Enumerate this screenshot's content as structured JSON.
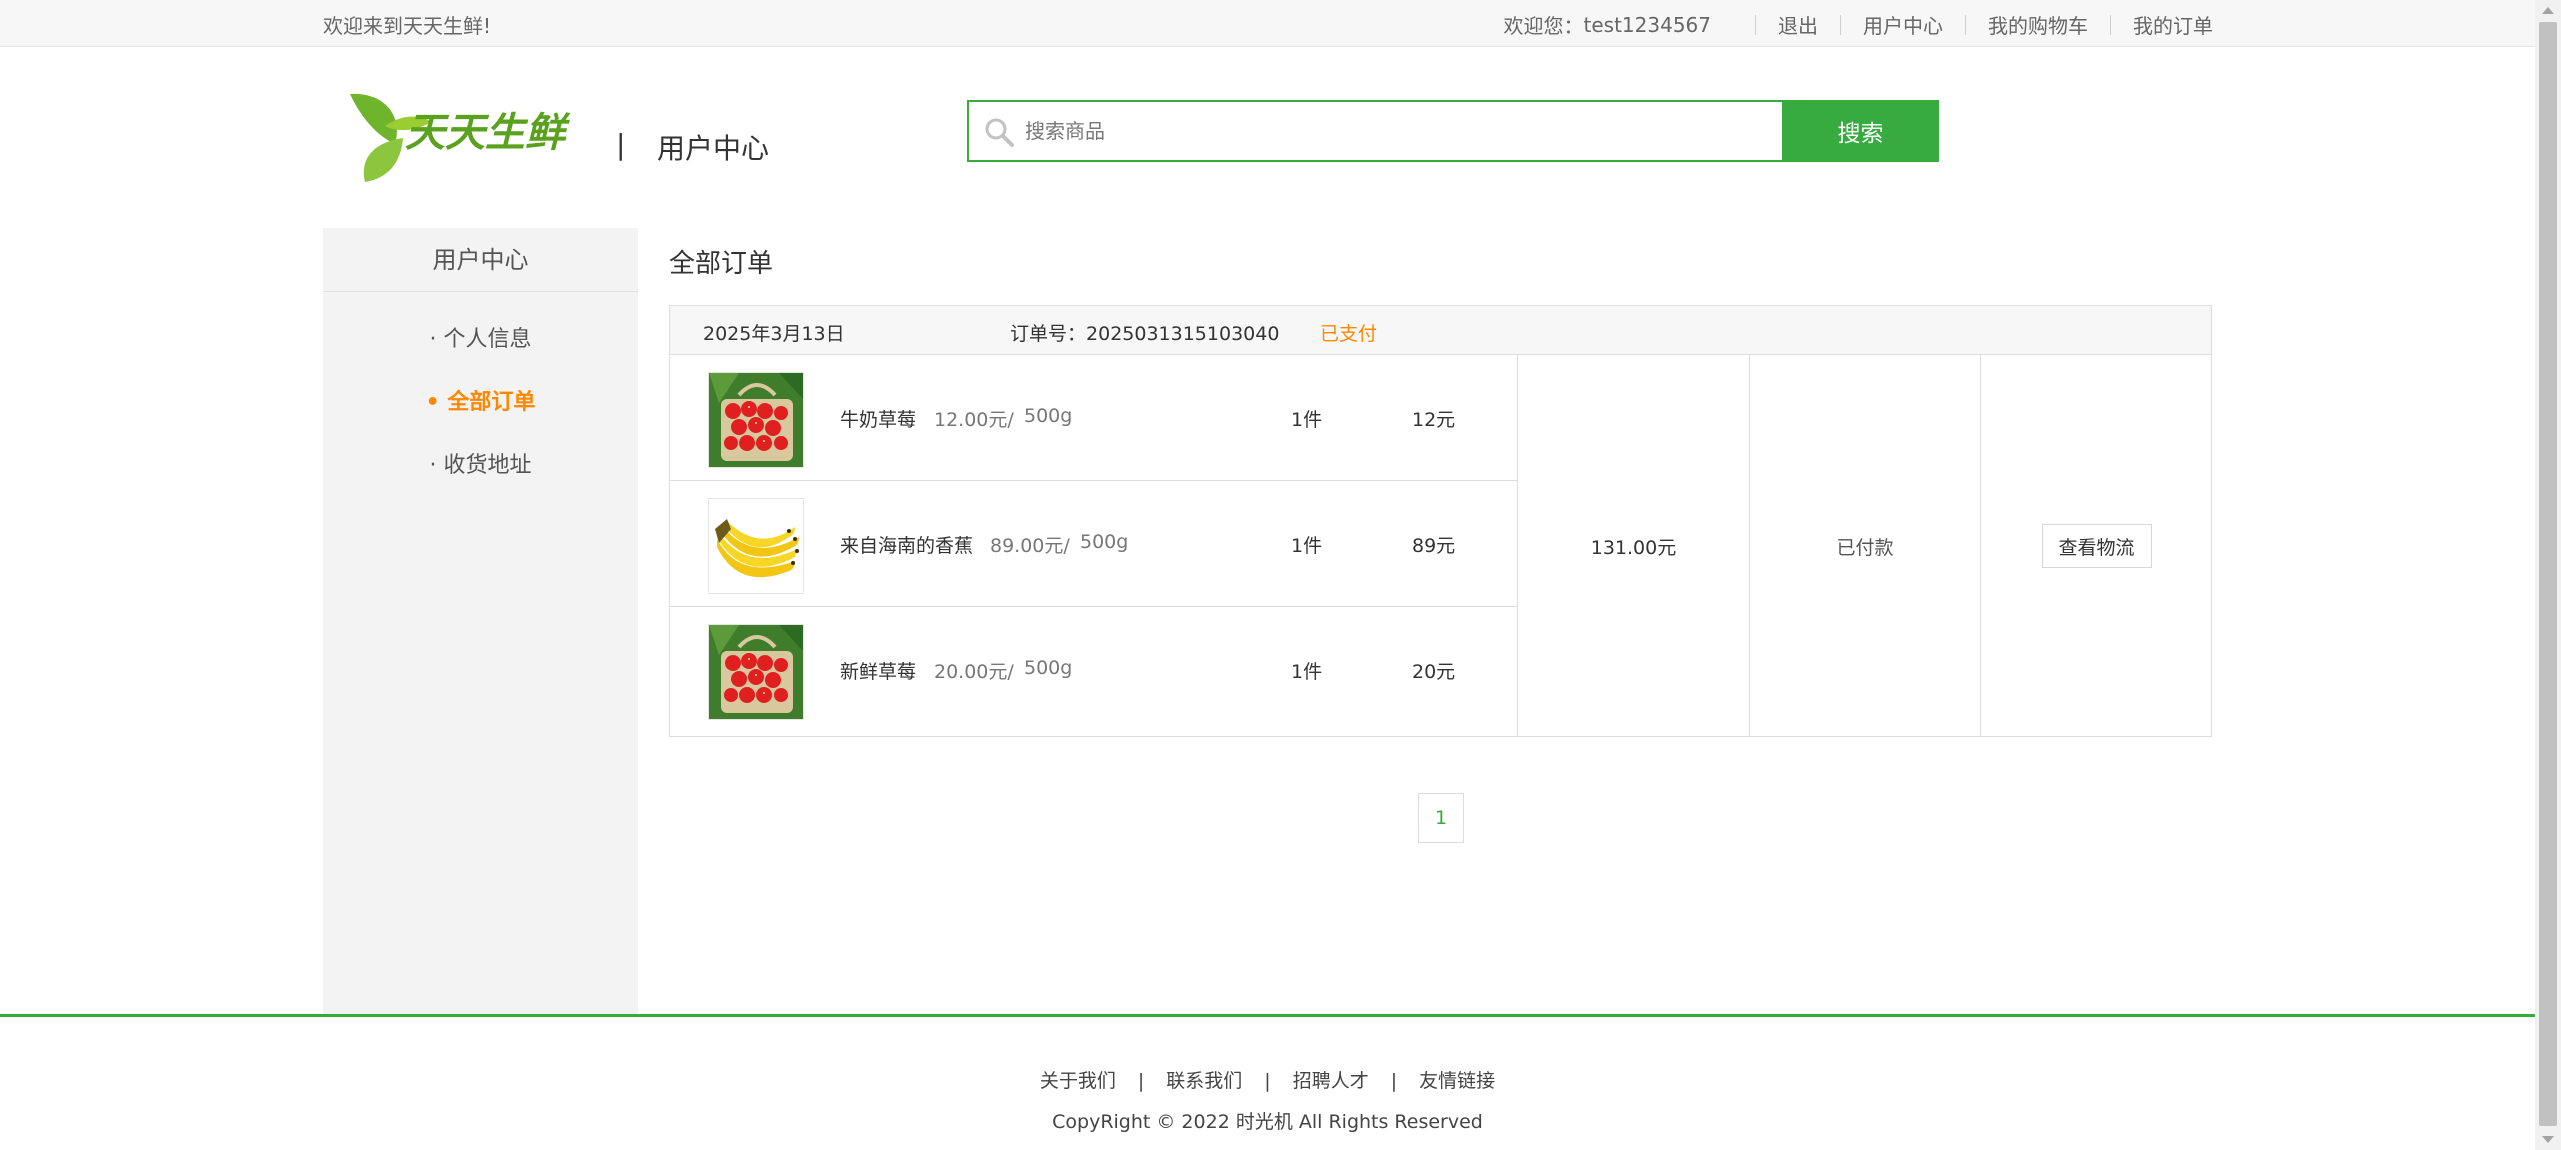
{
  "topbar": {
    "welcome": "欢迎来到天天生鲜!",
    "user_label": "欢迎您：",
    "username": "test1234567",
    "links": [
      "退出",
      "用户中心",
      "我的购物车",
      "我的订单"
    ]
  },
  "header": {
    "logo_text": "天天生鲜",
    "divider": "|",
    "subtitle": "用户中心",
    "search_placeholder": "搜索商品",
    "search_button": "搜索"
  },
  "sidebar": {
    "title": "用户中心",
    "items": [
      "· 个人信息",
      "• 全部订单",
      "· 收货地址"
    ],
    "active_index": 1
  },
  "main": {
    "title": "全部订单",
    "order": {
      "date": "2025年3月13日",
      "number_label": "订单号：",
      "number": "2025031315103040",
      "status": "已支付",
      "items": [
        {
          "name": "牛奶草莓",
          "price": "12.00元/",
          "unit": "500g",
          "qty": "1件",
          "subtotal": "12元",
          "image": "strawberry-basket-icon"
        },
        {
          "name": "来自海南的香蕉",
          "price": "89.00元/",
          "unit": "500g",
          "qty": "1件",
          "subtotal": "89元",
          "image": "banana-icon"
        },
        {
          "name": "新鲜草莓",
          "price": "20.00元/",
          "unit": "500g",
          "qty": "1件",
          "subtotal": "20元",
          "image": "strawberry-basket-icon"
        }
      ],
      "total": "131.00元",
      "pay_state": "已付款",
      "action": "查看物流"
    },
    "pagination": {
      "current": "1"
    }
  },
  "footer": {
    "links": [
      "关于我们",
      "联系我们",
      "招聘人才",
      "友情链接"
    ],
    "separator": "|",
    "copyright": "CopyRight © 2022 时光机 All Rights Reserved"
  },
  "colors": {
    "accent": "#37ab40",
    "orange": "#ff8800",
    "sidebar_bg": "#f3f3f3"
  }
}
